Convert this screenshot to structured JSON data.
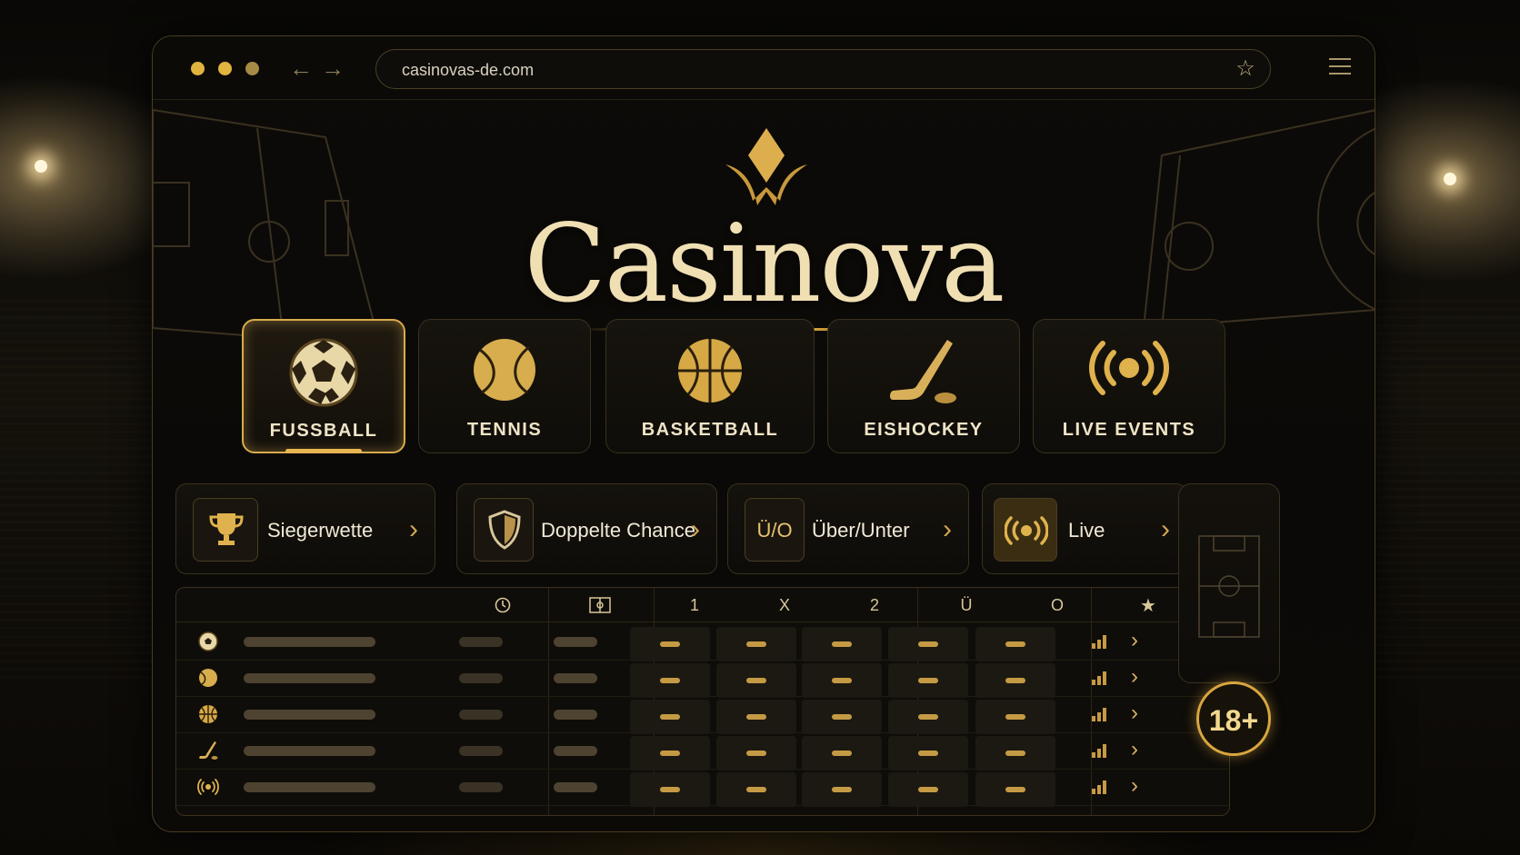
{
  "browser": {
    "url": "casinovas-de.com",
    "dots": [
      "#e1b440",
      "#e1b440",
      "#b09242"
    ]
  },
  "brand": {
    "logo_text": "Casinova",
    "accent": "#e1b440"
  },
  "sports": [
    {
      "label": "FUSSBALL",
      "icon": "soccer-ball-icon",
      "active": true
    },
    {
      "label": "TENNIS",
      "icon": "tennis-ball-icon",
      "active": false
    },
    {
      "label": "BASKETBALL",
      "icon": "basketball-icon",
      "active": false
    },
    {
      "label": "EISHOCKEY",
      "icon": "hockey-stick-icon",
      "active": false
    },
    {
      "label": "LIVE EVENTS",
      "icon": "broadcast-icon",
      "active": false
    }
  ],
  "bet_types": [
    {
      "label": "Siegerwette",
      "icon": "trophy-icon"
    },
    {
      "label": "Doppelte Chance",
      "icon": "shield-icon"
    },
    {
      "label": "Über/Unter",
      "icon_text": "Ü/O"
    },
    {
      "label": "Live",
      "icon": "broadcast-icon"
    }
  ],
  "table": {
    "headers": [
      "1",
      "X",
      "2",
      "Ü",
      "O"
    ],
    "header_icons": [
      "clock-icon",
      "field-icon",
      "star-icon"
    ],
    "rows": [
      {
        "icon": "soccer-ball-icon"
      },
      {
        "icon": "tennis-ball-icon"
      },
      {
        "icon": "basketball-icon"
      },
      {
        "icon": "hockey-stick-icon"
      },
      {
        "icon": "broadcast-icon"
      }
    ]
  },
  "age_badge": "18+"
}
